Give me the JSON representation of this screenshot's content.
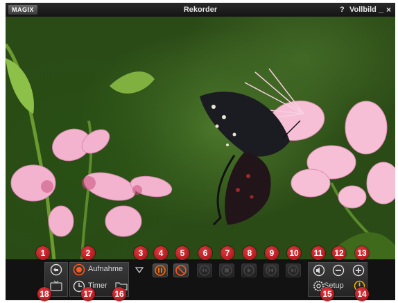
{
  "window": {
    "logo": "MAGIX",
    "title": "Rekorder",
    "help_label": "?",
    "fullscreen_label": "Vollbild",
    "minimize_label": "_",
    "close_label": "×"
  },
  "controls": {
    "record_label": "Aufnahme",
    "timer_label": "Timer",
    "setup_label": "Setup"
  },
  "callouts": [
    "1",
    "2",
    "3",
    "4",
    "5",
    "6",
    "7",
    "8",
    "9",
    "10",
    "11",
    "12",
    "13",
    "14",
    "15",
    "16",
    "17",
    "18"
  ],
  "colors": {
    "accent_red": "#c2161c",
    "record_orange": "#ff5a1f",
    "pause_orange": "#ff6a00"
  }
}
